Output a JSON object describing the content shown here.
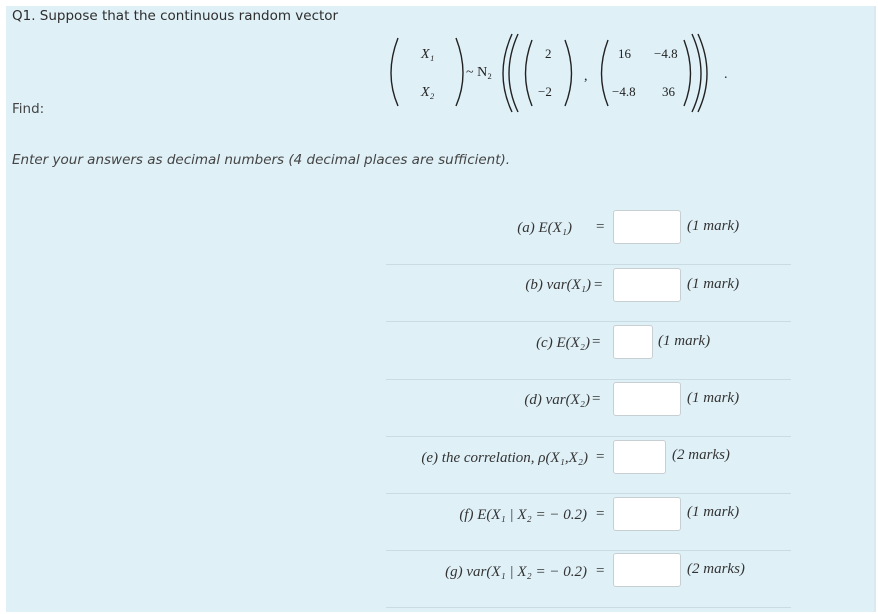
{
  "question": {
    "title": "Q1. Suppose that the continuous random vector",
    "find_label": "Find:",
    "instructions": "Enter your answers as decimal numbers (4 decimal places are sufficient)."
  },
  "distribution": {
    "x1": "X₁",
    "x2": "X₂",
    "symbol": "~ N₂",
    "mean": [
      "2",
      "−2"
    ],
    "cov": [
      "16",
      "−4.8",
      "−4.8",
      "36"
    ],
    "comma": ",",
    "period": "."
  },
  "parts": [
    {
      "label": "(a) E(X₁)",
      "eq": "=",
      "value": "",
      "marks": "(1 mark)"
    },
    {
      "label": "(b) var(X₁)",
      "eq": "=",
      "value": "",
      "marks": "(1 mark)"
    },
    {
      "label": "(c) E(X₂)",
      "eq": "=",
      "value": "",
      "marks": "(1 mark)"
    },
    {
      "label": "(d) var(X₂)",
      "eq": "=",
      "value": "",
      "marks": "(1 mark)"
    },
    {
      "label": "(e) the  correlation,  ρ(X₁,X₂)",
      "eq": "=",
      "value": "",
      "marks": "(2 marks)"
    },
    {
      "label": "(f) E(X₁ | X₂ = − 0.2)",
      "eq": "=",
      "value": "",
      "marks": "(1 mark)"
    },
    {
      "label": "(g) var(X₁ | X₂ = − 0.2)",
      "eq": "=",
      "value": "",
      "marks": "(2 marks)"
    }
  ]
}
